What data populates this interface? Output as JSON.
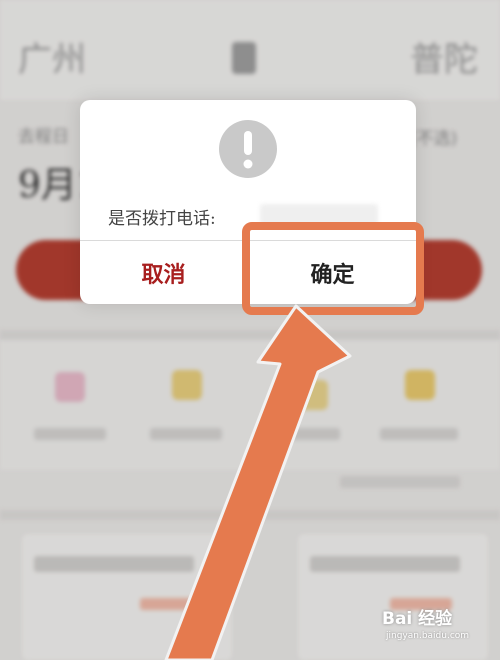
{
  "background": {
    "from_city": "广州",
    "to_city": "普陀",
    "date_label": "去程日",
    "optional_label": "(不选)",
    "date_value": "9月1"
  },
  "dialog": {
    "message": "是否拨打电话:",
    "cancel_label": "取消",
    "confirm_label": "确定"
  },
  "watermark": {
    "brand": "Bai 经验",
    "url": "jingyan.baidu.com"
  },
  "colors": {
    "accent": "#e57a4e",
    "cancel_text": "#a81e1e",
    "primary_button": "#b23a2c"
  }
}
